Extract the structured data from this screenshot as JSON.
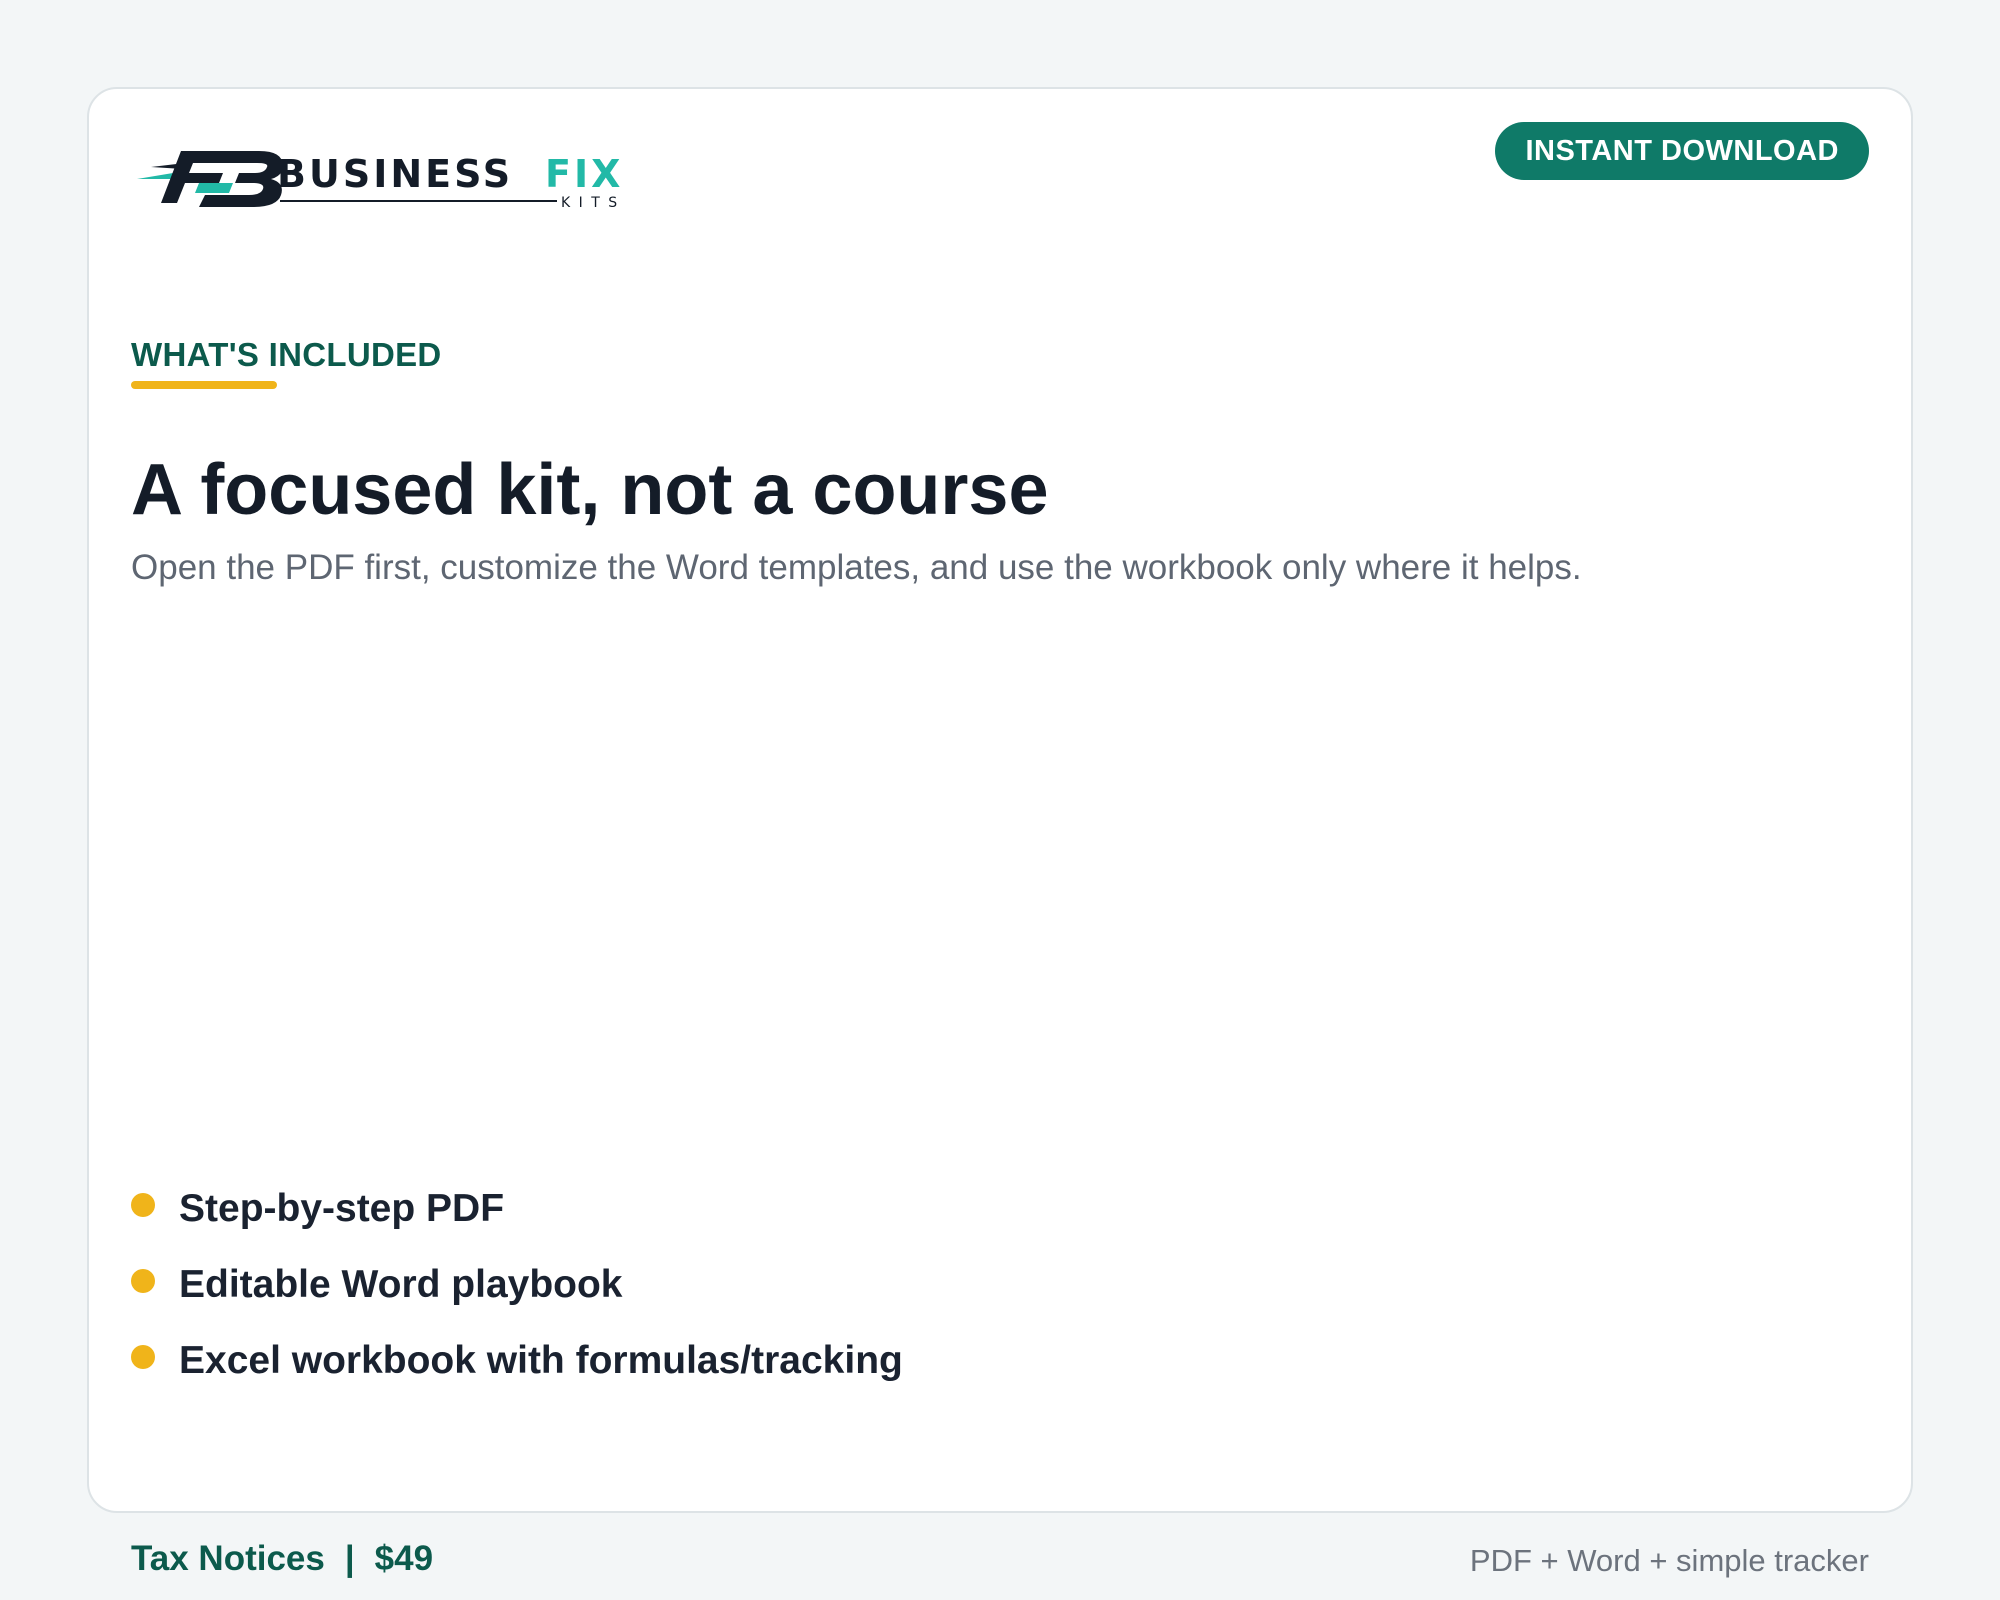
{
  "brand": {
    "name_part1": "BUSINESS",
    "name_part2": "FIX",
    "subname": "K I T S",
    "logo_icon": "fb-monogram-icon",
    "colors": {
      "dark": "#141c28",
      "accent": "#22b9a7"
    }
  },
  "header": {
    "download_label": "INSTANT DOWNLOAD"
  },
  "section": {
    "eyebrow": "WHAT'S INCLUDED",
    "headline": "A focused kit, not a course",
    "subhead": "Open the PDF first, customize the Word templates, and use the workbook only where it helps."
  },
  "features": [
    "Step-by-step PDF",
    "Editable Word playbook",
    "Excel workbook with formulas/tracking"
  ],
  "footer": {
    "product": "Tax Notices",
    "separator": "|",
    "price": "$49",
    "formats": "PDF + Word + simple tracker"
  },
  "colors": {
    "background": "#f3f6f7",
    "card": "#ffffff",
    "primary": "#0f7a68",
    "eyebrow": "#0c5a4c",
    "highlight": "#f0b41a",
    "text": "#141c28",
    "muted": "#5e6672"
  }
}
